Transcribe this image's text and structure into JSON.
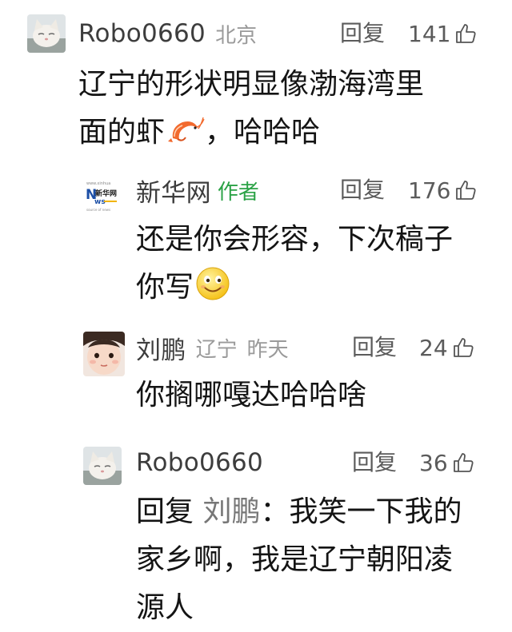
{
  "comments": [
    {
      "name": "Robo0660",
      "location": "北京",
      "reply_label": "回复",
      "likes": "141",
      "avatar_icon": "cat-avatar-icon",
      "text_1": "辽宁的形状明显像渤海湾里",
      "text_2a": "面的虾",
      "emoji": "shrimp-emoji-icon",
      "text_2b": "，哈哈哈"
    },
    {
      "name": "新华网",
      "badge": "作者",
      "reply_label": "回复",
      "likes": "176",
      "avatar_icon": "xinhuanet-logo-icon",
      "text_1": "还是你会形容，下次稿子",
      "text_2": "你写",
      "emoji": "smile-emoji-icon"
    },
    {
      "name": "刘鹏",
      "location": "辽宁",
      "time": "昨天",
      "reply_label": "回复",
      "likes": "24",
      "avatar_icon": "baby-avatar-icon",
      "text_1": "你搁哪嘎达哈哈啥"
    },
    {
      "name": "Robo0660",
      "reply_label": "回复",
      "likes": "36",
      "avatar_icon": "cat-avatar-icon",
      "reply_prefix": "回复",
      "mention": "刘鹏",
      "text_1": "：我笑一下我的",
      "text_2": "家乡啊，我是辽宁朝阳凌",
      "text_3": "源人"
    }
  ],
  "colors": {
    "author_badge": "#2ba246",
    "secondary_text": "#9a9a9a",
    "primary_text": "#141414"
  }
}
